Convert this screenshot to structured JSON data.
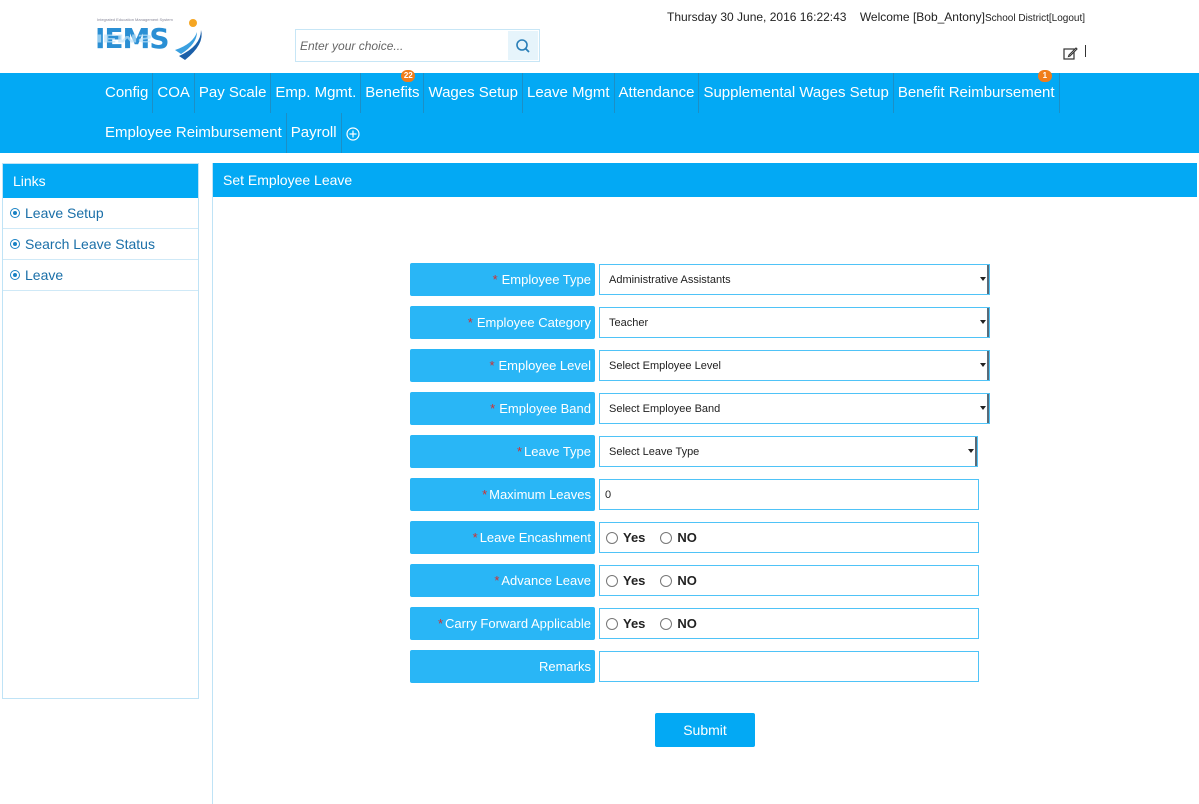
{
  "header": {
    "logo_text": "IEMS",
    "logo_tagline": "Integrated Education Management System",
    "search_placeholder": "Enter your choice...",
    "datetime": "Thursday 30 June, 2016 16:22:43",
    "welcome": "Welcome [Bob_Antony]",
    "district": "School District",
    "logout": "[Logout]"
  },
  "nav": {
    "row1": [
      {
        "label": "Config"
      },
      {
        "label": "COA"
      },
      {
        "label": "Pay Scale"
      },
      {
        "label": "Emp. Mgmt."
      },
      {
        "label": "Benefits",
        "badge": "22"
      },
      {
        "label": "Wages Setup"
      },
      {
        "label": "Leave Mgmt"
      },
      {
        "label": "Attendance"
      },
      {
        "label": "Supplemental Wages Setup"
      },
      {
        "label": "Benefit Reimbursement",
        "badge": "1"
      }
    ],
    "row2": [
      {
        "label": "Employee Reimbursement"
      },
      {
        "label": "Payroll"
      }
    ]
  },
  "links": {
    "title": "Links",
    "items": [
      {
        "label": "Leave Setup"
      },
      {
        "label": "Search Leave Status"
      },
      {
        "label": "Leave"
      }
    ]
  },
  "form": {
    "title": "Set Employee Leave",
    "employee_type": {
      "label": "Employee Type",
      "value": "Administrative Assistants"
    },
    "employee_category": {
      "label": "Employee Category",
      "value": "Teacher"
    },
    "employee_level": {
      "label": "Employee Level",
      "value": "Select Employee Level"
    },
    "employee_band": {
      "label": "Employee Band",
      "value": "Select Employee Band"
    },
    "leave_type": {
      "label": "Leave Type",
      "value": "Select Leave Type"
    },
    "maximum_leaves": {
      "label": "Maximum Leaves",
      "value": "0"
    },
    "leave_encashment": {
      "label": "Leave Encashment",
      "yes": "Yes",
      "no": "NO"
    },
    "advance_leave": {
      "label": "Advance Leave",
      "yes": "Yes",
      "no": "NO"
    },
    "carry_forward": {
      "label": "Carry Forward Applicable",
      "yes": "Yes",
      "no": "NO"
    },
    "remarks": {
      "label": "Remarks",
      "value": ""
    },
    "required_mark": "*",
    "submit_label": "Submit"
  },
  "colors": {
    "primary": "#03a9f4",
    "label_bg": "#29b6f6",
    "badge": "#f07d1a",
    "required": "#d32f2f"
  }
}
